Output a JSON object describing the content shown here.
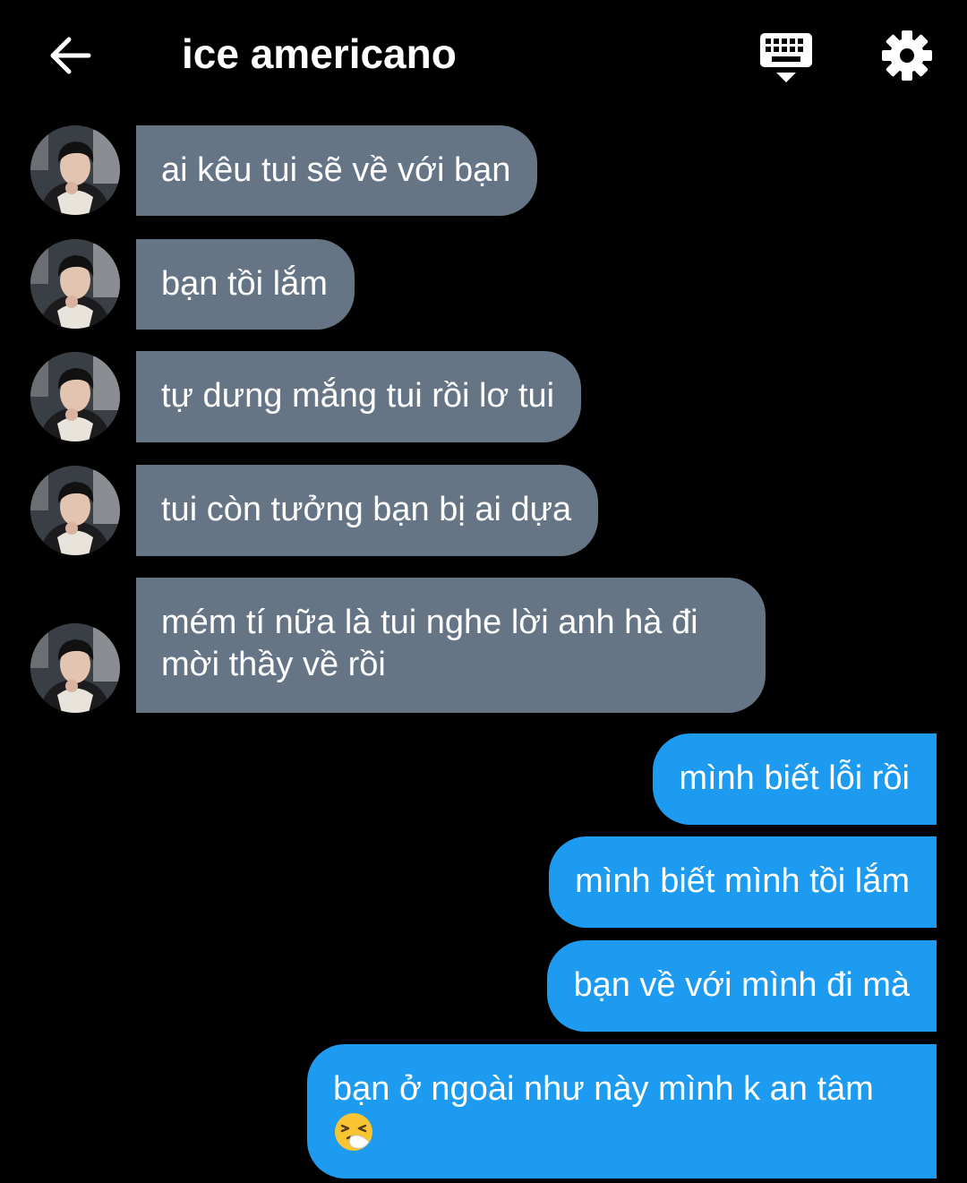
{
  "header": {
    "title": "ice americano",
    "back_icon": "arrow-left-icon",
    "keyboard_icon": "keyboard-icon",
    "settings_icon": "gear-icon"
  },
  "messages": [
    {
      "sender": "other",
      "text": "ai kêu tui sẽ về với bạn"
    },
    {
      "sender": "other",
      "text": "bạn tồi lắm"
    },
    {
      "sender": "other",
      "text": "tự dưng mắng tui rồi lơ tui"
    },
    {
      "sender": "other",
      "text": "tui còn tưởng bạn bị ai dựa"
    },
    {
      "sender": "other",
      "line1": "mém tí nữa là tui nghe lời anh hà đi",
      "line2": "mời thầy về rồi"
    },
    {
      "sender": "me",
      "text": "mình biết lỗi rồi"
    },
    {
      "sender": "me",
      "text": "mình biết mình tồi lắm"
    },
    {
      "sender": "me",
      "text": "bạn về với mình đi mà"
    },
    {
      "sender": "me",
      "text": "bạn ở ngoài như này mình k an tâm",
      "emoji": "sneezing-face-icon"
    }
  ],
  "colors": {
    "background": "#000000",
    "incoming_bubble": "#657585",
    "outgoing_bubble": "#1d9bf0",
    "text": "#ffffff"
  }
}
